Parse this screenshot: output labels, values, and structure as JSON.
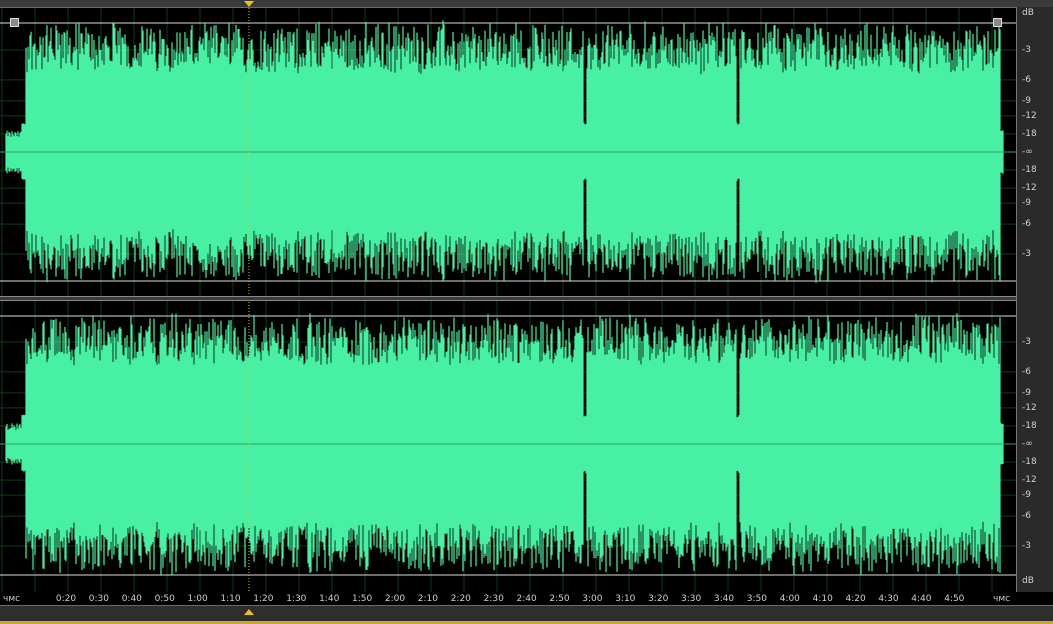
{
  "window": {
    "title": ""
  },
  "colors": {
    "waveform": "#47f0a3",
    "grid": "#0f3a1a",
    "boundary": "#dddddd",
    "playhead": "#e8c21c",
    "background": "#000000"
  },
  "ruler": {
    "db_unit": "dB",
    "channel1_labels": [
      "-3",
      "-6",
      "-9",
      "-12",
      "-18",
      "-∞",
      "-18",
      "-12",
      "-9",
      "-6",
      "-3"
    ],
    "channel2_labels": [
      "-3",
      "-6",
      "-9",
      "-12",
      "-18",
      "-∞",
      "-18",
      "-12",
      "-9",
      "-6",
      "-3"
    ],
    "db_unit_bottom": "dB"
  },
  "timeline": {
    "unit_left": "чмс",
    "unit_right": "чмс",
    "labels": [
      "0:20",
      "0:30",
      "0:40",
      "0:50",
      "1:00",
      "1:10",
      "1:20",
      "1:30",
      "1:40",
      "1:50",
      "2:00",
      "2:10",
      "2:20",
      "2:30",
      "2:40",
      "2:50",
      "3:00",
      "3:10",
      "3:20",
      "3:30",
      "3:40",
      "3:50",
      "4:00",
      "4:10",
      "4:20",
      "4:30",
      "4:40",
      "4:50"
    ]
  }
}
